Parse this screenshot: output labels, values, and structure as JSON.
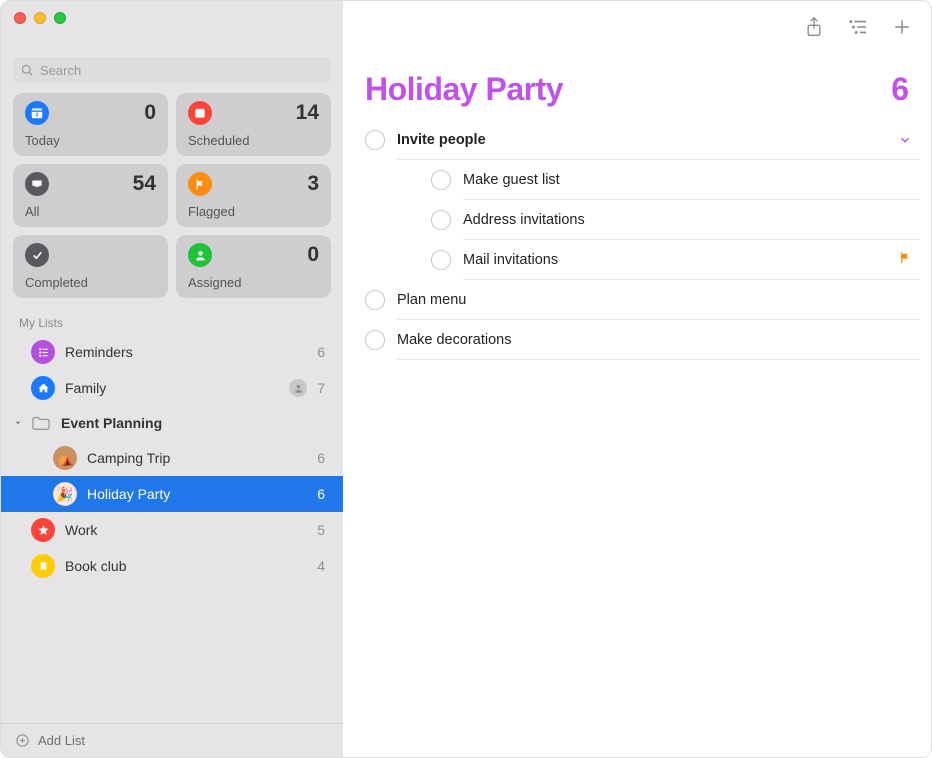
{
  "search": {
    "placeholder": "Search"
  },
  "smart": [
    {
      "key": "today",
      "label": "Today",
      "count": 0
    },
    {
      "key": "scheduled",
      "label": "Scheduled",
      "count": 14
    },
    {
      "key": "all",
      "label": "All",
      "count": 54
    },
    {
      "key": "flagged",
      "label": "Flagged",
      "count": 3
    },
    {
      "key": "completed",
      "label": "Completed",
      "count": ""
    },
    {
      "key": "assigned",
      "label": "Assigned",
      "count": 0
    }
  ],
  "mylists_header": "My Lists",
  "lists": {
    "reminders": {
      "name": "Reminders",
      "count": 6
    },
    "family": {
      "name": "Family",
      "count": 7,
      "shared": true
    },
    "group": {
      "name": "Event Planning"
    },
    "camping": {
      "name": "Camping Trip",
      "count": 6
    },
    "holiday": {
      "name": "Holiday Party",
      "count": 6
    },
    "work": {
      "name": "Work",
      "count": 5
    },
    "bookclub": {
      "name": "Book club",
      "count": 4
    }
  },
  "footer": {
    "add_list": "Add List"
  },
  "main": {
    "title": "Holiday Party",
    "count": 6,
    "reminders": [
      {
        "text": "Invite people",
        "bold": true,
        "expandable": true
      },
      {
        "text": "Make guest list",
        "sub": true
      },
      {
        "text": "Address invitations",
        "sub": true
      },
      {
        "text": "Mail invitations",
        "sub": true,
        "flagged": true
      },
      {
        "text": "Plan menu"
      },
      {
        "text": "Make decorations"
      }
    ]
  }
}
